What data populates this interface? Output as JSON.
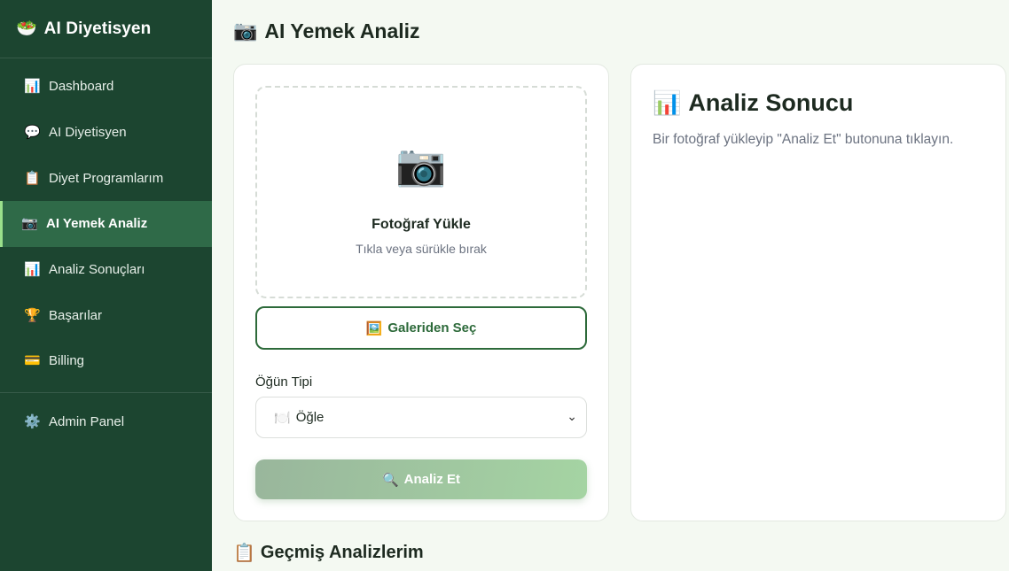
{
  "sidebar": {
    "brand": {
      "icon": "🥗",
      "title": "AI Diyetisyen"
    },
    "items": [
      {
        "icon": "📊",
        "label": "Dashboard"
      },
      {
        "icon": "💬",
        "label": "AI Diyetisyen"
      },
      {
        "icon": "📋",
        "label": "Diyet Programlarım"
      },
      {
        "icon": "📷",
        "label": "AI Yemek Analiz"
      },
      {
        "icon": "📊",
        "label": "Analiz Sonuçları"
      },
      {
        "icon": "🏆",
        "label": "Başarılar"
      },
      {
        "icon": "💳",
        "label": "Billing"
      }
    ],
    "admin": {
      "icon": "⚙️",
      "label": "Admin Panel"
    }
  },
  "page": {
    "icon": "📷",
    "title": "AI Yemek Analiz"
  },
  "upload": {
    "camera_icon": "📷",
    "title": "Fotoğraf Yükle",
    "subtitle": "Tıkla veya sürükle bırak",
    "gallery_icon": "🖼️",
    "gallery_label": "Galeriden Seç",
    "meal_label": "Öğün Tipi",
    "meal_icon": "🍽️",
    "meal_value": "Öğle",
    "analyze_icon": "🔍",
    "analyze_label": "Analiz Et"
  },
  "result": {
    "icon": "📊",
    "title": "Analiz Sonucu",
    "text": "Bir fotoğraf yükleyip \"Analiz Et\" butonuna tıklayın."
  },
  "history": {
    "icon": "📋",
    "title": "Geçmiş Analizlerim"
  },
  "colors": {
    "sidebar_bg": "#1c4530",
    "active_bg": "#2f6a48",
    "accent": "#2d6a3a"
  }
}
